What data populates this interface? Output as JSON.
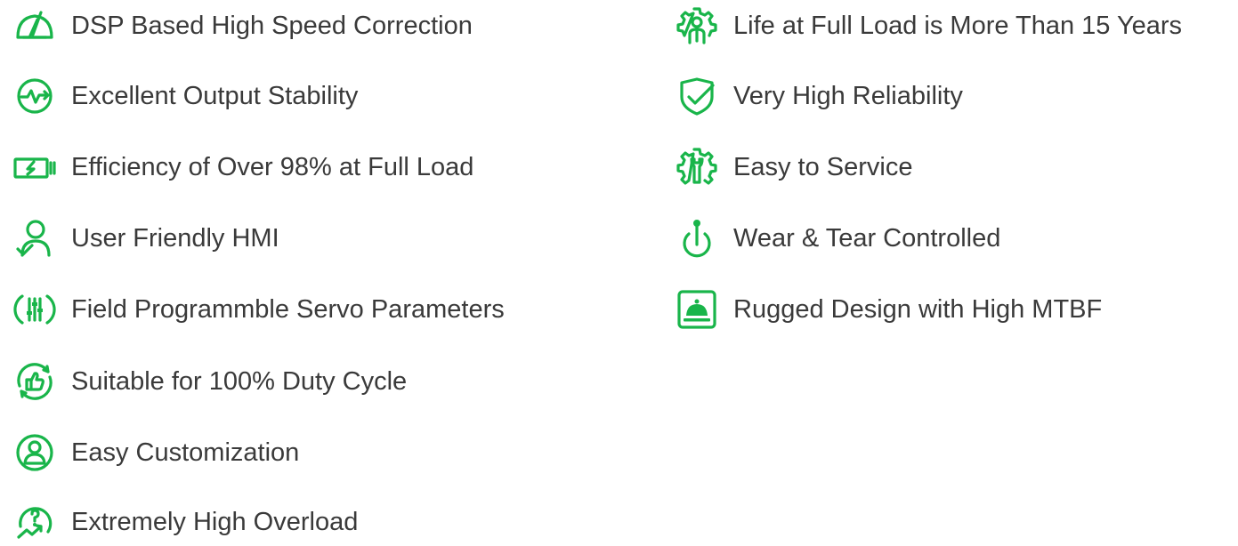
{
  "accent_color": "#19b54a",
  "text_color": "#3a3a3a",
  "left_features": [
    {
      "label": "DSP Based High Speed Correction",
      "icon": "speedometer-icon"
    },
    {
      "label": "Excellent Output Stability",
      "icon": "stability-wave-icon"
    },
    {
      "label": "Efficiency of Over 98% at Full Load",
      "icon": "battery-charge-icon"
    },
    {
      "label": "User Friendly HMI",
      "icon": "user-check-icon"
    },
    {
      "label": "Field Programmble Servo Parameters",
      "icon": "slider-controls-icon"
    },
    {
      "label": "Suitable for 100% Duty Cycle",
      "icon": "thumbs-up-cycle-icon"
    },
    {
      "label": "Easy Customization",
      "icon": "user-circle-icon"
    },
    {
      "label": "Extremely High Overload",
      "icon": "overload-hook-icon"
    }
  ],
  "right_features": [
    {
      "label": "Life at Full Load is More Than 15 Years",
      "icon": "gear-person-icon"
    },
    {
      "label": "Very High Reliability",
      "icon": "shield-check-icon"
    },
    {
      "label": "Easy to Service",
      "icon": "gear-wrench-icon"
    },
    {
      "label": "Wear & Tear Controlled",
      "icon": "joystick-icon"
    },
    {
      "label": "Rugged Design with High MTBF",
      "icon": "service-bell-icon"
    }
  ]
}
